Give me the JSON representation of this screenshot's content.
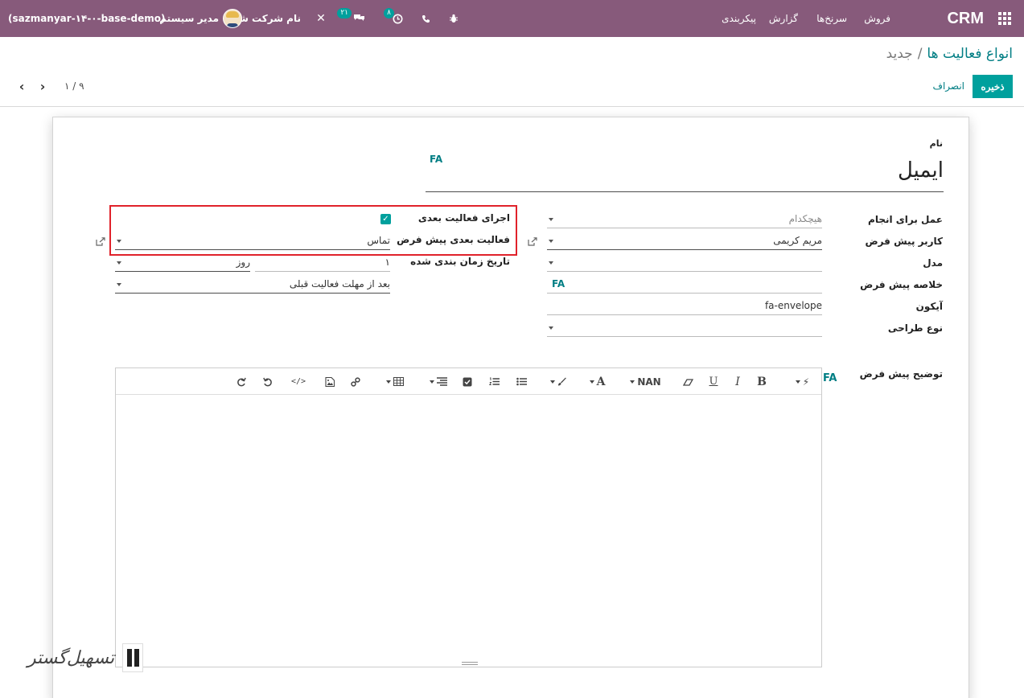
{
  "navbar": {
    "brand": "CRM",
    "menu": {
      "sales": "فروش",
      "leads": "سرنخ‌ها",
      "report": "گزارش",
      "config": "پیکربندی"
    },
    "badges": {
      "activities": "۸",
      "messages": "۲۱"
    },
    "company": "نام شرکت شما",
    "user": "مدیر سیستم",
    "database": "(sazmanyar-۱۴-۰-base-demo)"
  },
  "control_panel": {
    "breadcrumb_parent": "انواع فعالیت ها",
    "breadcrumb_sep": "/",
    "breadcrumb_current": "جدید",
    "save_label": "ذخیره",
    "discard_label": "انصراف",
    "pager": "۱ / ۹"
  },
  "form": {
    "name_label": "نام",
    "name_value": "ایمیل",
    "lang_tag": "FA",
    "right": {
      "action_label": "عمل برای انجام",
      "action_value": "هیچکدام",
      "default_user_label": "کاربر پیش فرض",
      "default_user_value": "مریم کریمی",
      "model_label": "مدل",
      "summary_label": "خلاصه پیش فرض",
      "icon_label": "آیکون",
      "icon_value": "fa-envelope",
      "decoration_label": "نوع طراحی",
      "description_label": "توضیح پیش فرض"
    },
    "left": {
      "trigger_label": "اجرای فعالیت بعدی",
      "trigger_checked": true,
      "default_next_label": "فعالیت بعدی پیش فرض",
      "default_next_value": "تماس",
      "schedule_label": "تاریخ زمان بندی شده",
      "delay_count": "۱",
      "delay_unit": "روز",
      "delay_from": "بعد از مهلت فعالیت قبلی"
    }
  },
  "editor_toolbar": {
    "font_size": "NAN",
    "bold": "B",
    "italic": "I",
    "underline": "U",
    "font_color": "A"
  },
  "watermark": {
    "text": "تسهیل‌گستر"
  }
}
